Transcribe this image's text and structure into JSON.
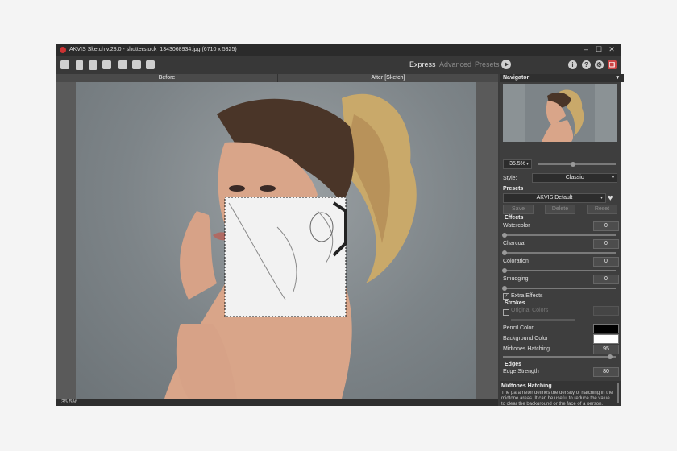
{
  "window": {
    "title": "AKVIS Sketch v.28.0 - shutterstock_1343068934.jpg (6710 x 5325)",
    "controls": [
      "–",
      "☐",
      "✕"
    ]
  },
  "toolbar": {
    "icons": [
      "open-icon",
      "save-icon",
      "export-icon",
      "print-icon",
      "before-after-icon",
      "batch-icon",
      "tools-icon"
    ],
    "modes": [
      "Express",
      "Advanced",
      "Presets"
    ],
    "active_mode": "Express",
    "right_icons": [
      "info-icon",
      "help-icon",
      "settings-icon",
      "bookmark-icon"
    ]
  },
  "tabs": {
    "before": "Before",
    "after": "After [Sketch]"
  },
  "status": {
    "zoom": "35.5%"
  },
  "navigator": {
    "title": "Navigator",
    "zoom": "35.5%",
    "zoom_level": 0.45
  },
  "style": {
    "label": "Style:",
    "value": "Classic"
  },
  "presets": {
    "title": "Presets",
    "value": "AKVIS Default",
    "save": "Save",
    "delete": "Delete",
    "reset": "Reset"
  },
  "effects": {
    "title": "Effects",
    "items": [
      {
        "label": "Watercolor",
        "value": "0"
      },
      {
        "label": "Charcoal",
        "value": "0"
      },
      {
        "label": "Coloration",
        "value": "0"
      },
      {
        "label": "Smudging",
        "value": "0"
      }
    ],
    "extra_effects": "Extra Effects"
  },
  "strokes": {
    "title": "Strokes",
    "original_colors": "Original Colors",
    "pencil_color": "Pencil Color",
    "background_color": "Background Color",
    "pencil_hex": "#000000",
    "background_hex": "#ffffff",
    "midtones_label": "Midtones Hatching",
    "midtones_value": "95"
  },
  "edges": {
    "title": "Edges",
    "strength_label": "Edge Strength",
    "strength_value": "80"
  },
  "help": {
    "title": "Midtones Hatching",
    "body": "The parameter defines the density of hatching in the midtone areas. It can be useful to reduce the value to clear the background or the face of a person."
  }
}
